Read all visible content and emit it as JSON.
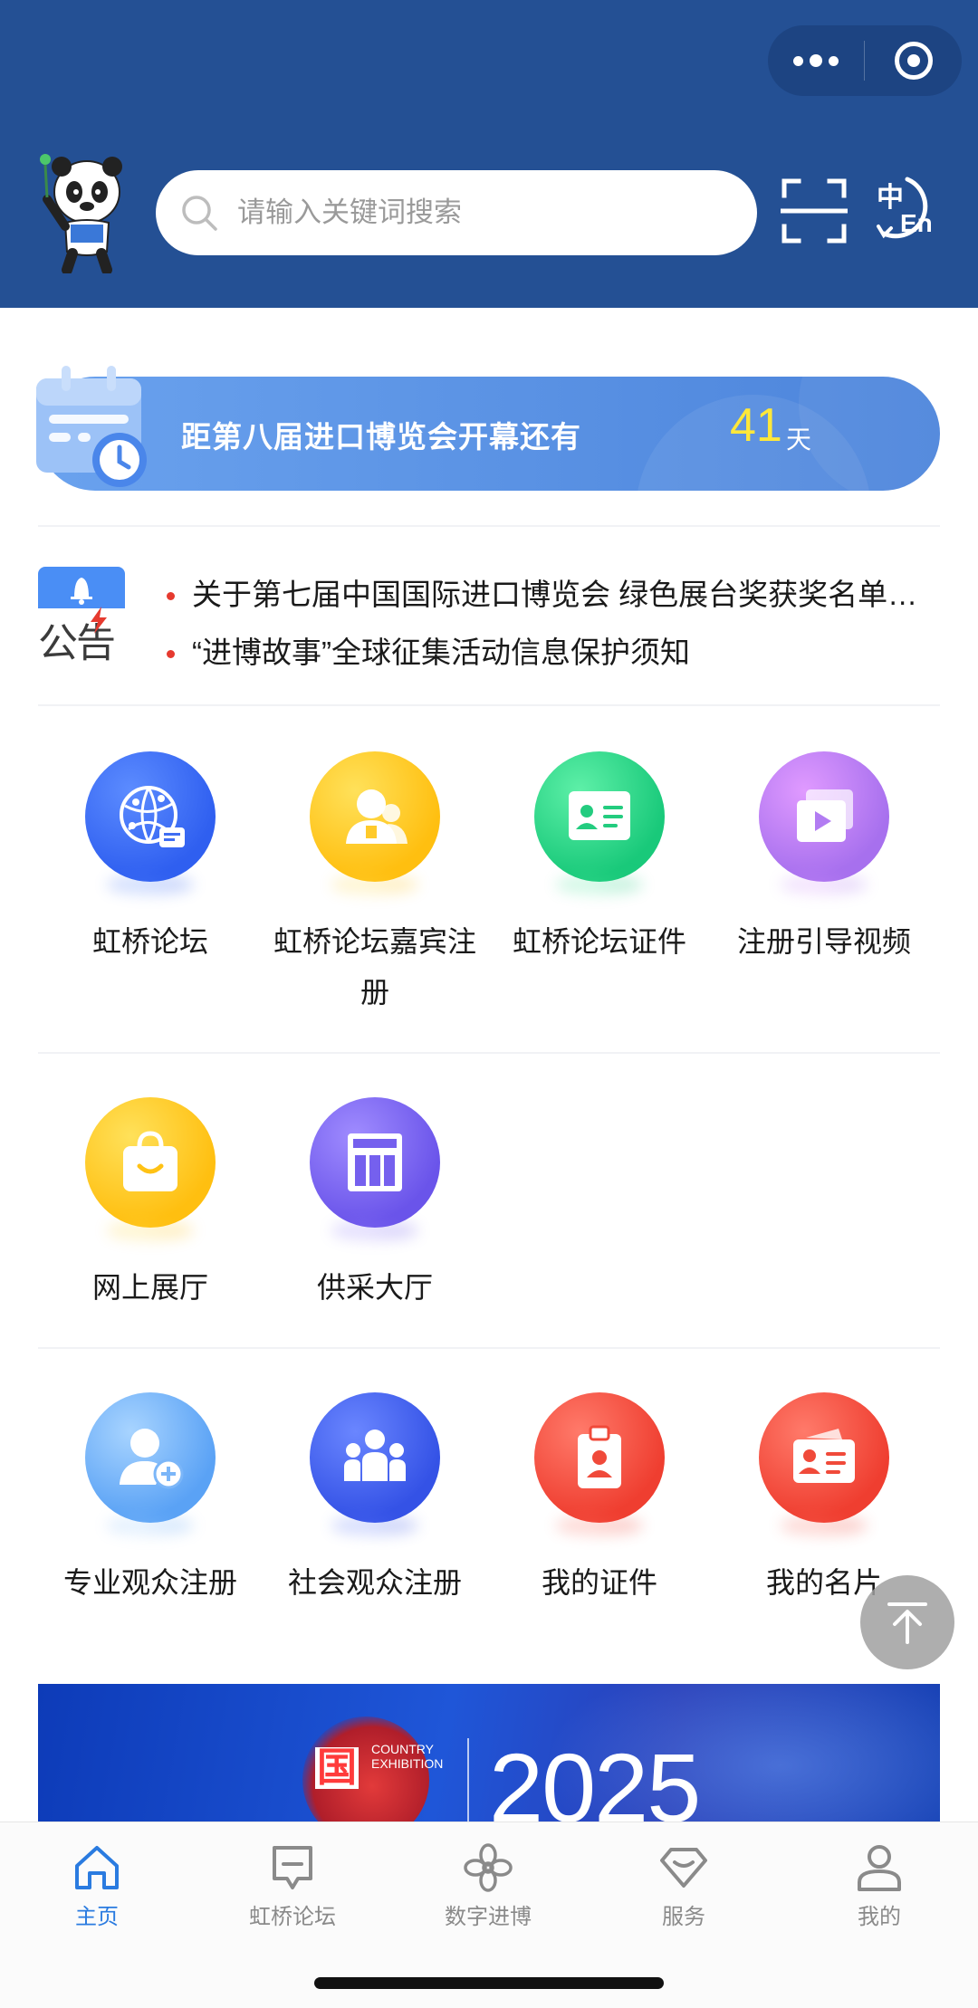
{
  "header": {
    "search_placeholder": "请输入关键词搜索",
    "icons": [
      "panda-mascot-icon",
      "search-icon",
      "scan-icon",
      "language-switch-icon",
      "more-dots-icon",
      "close-target-icon"
    ],
    "lang_label_zh": "中",
    "lang_label_en": "En"
  },
  "countdown": {
    "text": "距第八届进口博览会开幕还有",
    "days": "41",
    "unit": "天"
  },
  "notice": {
    "label": "公告",
    "items": [
      "关于第七届中国国际进口博览会 绿色展台奖获奖名单公示",
      "“进博故事”全球征集活动信息保护须知"
    ]
  },
  "grid": {
    "row1": [
      {
        "label": "虹桥论坛",
        "icon": "globe-chat-icon"
      },
      {
        "label": "虹桥论坛嘉宾注册",
        "icon": "guest-person-icon"
      },
      {
        "label": "虹桥论坛证件",
        "icon": "id-card-icon"
      },
      {
        "label": "注册引导视频",
        "icon": "video-play-icon"
      }
    ],
    "row2": [
      {
        "label": "网上展厅",
        "icon": "shopping-bag-icon"
      },
      {
        "label": "供采大厅",
        "icon": "hall-building-icon"
      }
    ],
    "row3": [
      {
        "label": "专业观众注册",
        "icon": "add-user-icon"
      },
      {
        "label": "社会观众注册",
        "icon": "group-users-icon"
      },
      {
        "label": "我的证件",
        "icon": "badge-icon"
      },
      {
        "label": "我的名片",
        "icon": "business-card-icon"
      }
    ]
  },
  "banner": {
    "guo": "国",
    "country": "COUNTRY",
    "exhibition": "EXHIBITION",
    "year": "2025"
  },
  "tabbar": {
    "items": [
      {
        "label": "主页",
        "icon": "home-icon",
        "active": true
      },
      {
        "label": "虹桥论坛",
        "icon": "message-icon",
        "active": false
      },
      {
        "label": "数字进博",
        "icon": "flower-icon",
        "active": false
      },
      {
        "label": "服务",
        "icon": "gem-icon",
        "active": false
      },
      {
        "label": "我的",
        "icon": "person-icon",
        "active": false
      }
    ]
  },
  "colors": {
    "header_bg": "#245094",
    "accent": "#2a7be0",
    "countdown_days": "#ffe83a",
    "notice_dot": "#e63a2f"
  }
}
